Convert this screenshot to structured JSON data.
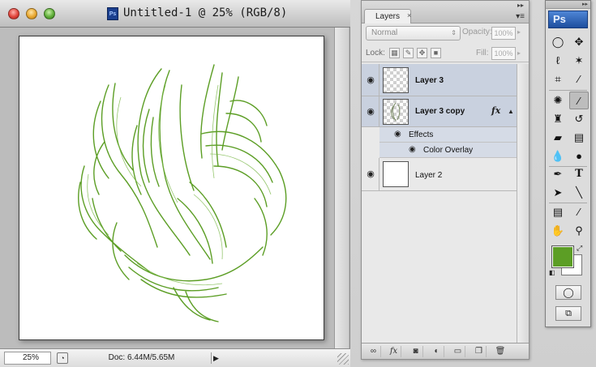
{
  "document": {
    "title": "Untitled-1 @ 25% (RGB/8)",
    "app_badge": "Ps",
    "zoom": "25%",
    "doc_info": "Doc: 6.44M/5.65M"
  },
  "layers_panel": {
    "tab_label": "Layers",
    "blend_mode": "Normal",
    "opacity_label": "Opacity:",
    "opacity_value": "100%",
    "lock_label": "Lock:",
    "fill_label": "Fill:",
    "fill_value": "100%",
    "layers": [
      {
        "name": "Layer 3",
        "selected": true,
        "thumb": "transparent"
      },
      {
        "name": "Layer 3 copy",
        "selected": true,
        "thumb": "transparent-art",
        "fx": "fx"
      },
      {
        "name": "Layer 2",
        "selected": false,
        "thumb": "white"
      }
    ],
    "effects_label": "Effects",
    "effect_items": [
      "Color Overlay"
    ]
  },
  "tools_panel": {
    "logo": "Ps",
    "foreground_color": "#5c9e25",
    "background_color": "#ffffff"
  },
  "colors": {
    "artwork_green": "#5c9e25",
    "selection": "#c9d1df"
  }
}
